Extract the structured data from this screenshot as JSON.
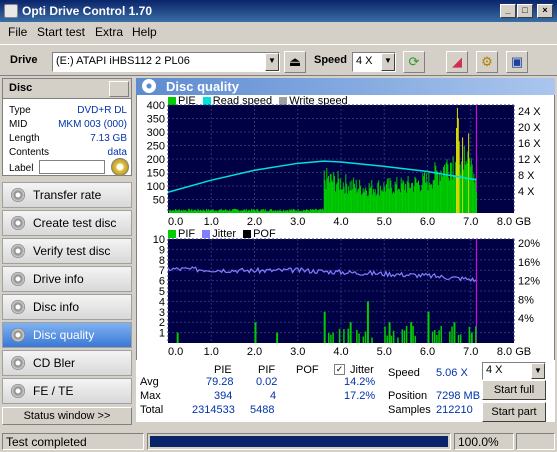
{
  "window": {
    "title": "Opti Drive Control 1.70"
  },
  "menu": [
    "File",
    "Start test",
    "Extra",
    "Help"
  ],
  "toolbar": {
    "drive_label": "Drive",
    "drive_value": "(E:)   ATAPI  iHBS112   2 PL06",
    "speed_label": "Speed",
    "speed_value": "4 X"
  },
  "disc": {
    "header": "Disc",
    "rows": [
      {
        "label": "Type",
        "value": "DVD+R DL"
      },
      {
        "label": "MID",
        "value": "MKM 003 (000)"
      },
      {
        "label": "Length",
        "value": "7.13 GB"
      },
      {
        "label": "Contents",
        "value": "data"
      },
      {
        "label": "Label",
        "value": ""
      }
    ]
  },
  "nav": [
    {
      "label": "Transfer rate",
      "active": false
    },
    {
      "label": "Create test disc",
      "active": false
    },
    {
      "label": "Verify test disc",
      "active": false
    },
    {
      "label": "Drive info",
      "active": false
    },
    {
      "label": "Disc info",
      "active": false
    },
    {
      "label": "Disc quality",
      "active": true
    },
    {
      "label": "CD Bler",
      "active": false
    },
    {
      "label": "FE / TE",
      "active": false
    }
  ],
  "status_window_label": "Status window >>",
  "panel": {
    "title": "Disc quality"
  },
  "chart_data": [
    {
      "type": "bar",
      "series": [
        {
          "name": "PIE",
          "color": "#00cc00"
        },
        {
          "name": "Read speed",
          "color": "#00e0e0"
        },
        {
          "name": "Write speed",
          "color": "#a0a0a0"
        }
      ],
      "x_ticks": [
        "0.0",
        "1.0",
        "2.0",
        "3.0",
        "4.0",
        "5.0",
        "6.0",
        "7.0",
        "8.0 GB"
      ],
      "y_ticks_left": [
        "400",
        "350",
        "300",
        "250",
        "200",
        "150",
        "100",
        "50"
      ],
      "y_ticks_right": [
        "24 X",
        "20 X",
        "16 X",
        "12 X",
        "8 X",
        "4 X"
      ],
      "xlim": [
        0,
        8
      ],
      "ylim": [
        0,
        400
      ],
      "read_speed": {
        "x": [
          0,
          1,
          2,
          3,
          3.6,
          4,
          5,
          6,
          7,
          7.13
        ],
        "y": [
          4.8,
          7.6,
          9.9,
          11.5,
          12.0,
          11.8,
          10.8,
          9.6,
          7.9,
          7.7
        ]
      },
      "pie_profile": {
        "x": [
          3.6,
          4.5,
          5.5,
          6.0,
          6.5,
          7.0,
          7.13
        ],
        "y": [
          150,
          110,
          120,
          140,
          220,
          270,
          80
        ]
      }
    },
    {
      "type": "bar",
      "series": [
        {
          "name": "PIF",
          "color": "#00cc00"
        },
        {
          "name": "Jitter",
          "color": "#8080ff"
        },
        {
          "name": "POF",
          "color": "#000000"
        }
      ],
      "x_ticks": [
        "0.0",
        "1.0",
        "2.0",
        "3.0",
        "4.0",
        "5.0",
        "6.0",
        "7.0",
        "8.0 GB"
      ],
      "y_ticks_left": [
        "10",
        "9",
        "8",
        "7",
        "6",
        "5",
        "4",
        "3",
        "2",
        "1"
      ],
      "y_ticks_right": [
        "20%",
        "16%",
        "12%",
        "8%",
        "4%"
      ],
      "xlim": [
        0,
        8
      ],
      "ylim": [
        0,
        10
      ],
      "jitter": {
        "x": [
          0,
          1,
          2,
          3,
          4,
          5,
          6,
          7,
          7.13
        ],
        "y": [
          15.0,
          14.8,
          14.6,
          14.7,
          14.3,
          14.0,
          13.6,
          12.9,
          12.6
        ]
      },
      "pif_spikes": {
        "x": [
          0.2,
          2.0,
          2.5,
          3.6,
          4.2,
          4.6,
          5.1,
          5.6,
          6.0,
          6.6,
          7.0
        ],
        "y": [
          1,
          2,
          1,
          3,
          2,
          4,
          2,
          2,
          3,
          2,
          1
        ]
      }
    }
  ],
  "stats": {
    "headers": [
      "PIE",
      "PIF",
      "POF"
    ],
    "jitter_label": "Jitter",
    "jitter_checked": true,
    "rows": [
      {
        "label": "Avg",
        "pie": "79.28",
        "pif": "0.02",
        "pof": "",
        "jitter": "14.2%"
      },
      {
        "label": "Max",
        "pie": "394",
        "pif": "4",
        "pof": "",
        "jitter": "17.2%"
      },
      {
        "label": "Total",
        "pie": "2314533",
        "pif": "5488",
        "pof": "",
        "jitter": ""
      }
    ],
    "speed_label": "Speed",
    "speed_value": "5.06 X",
    "position_label": "Position",
    "position_value": "7298 MB",
    "samples_label": "Samples",
    "samples_value": "212210",
    "speed_combo": "4 X",
    "start_full": "Start full",
    "start_part": "Start part"
  },
  "statusbar": {
    "text": "Test completed",
    "progress": 1.0,
    "progress_text": "100.0%"
  }
}
